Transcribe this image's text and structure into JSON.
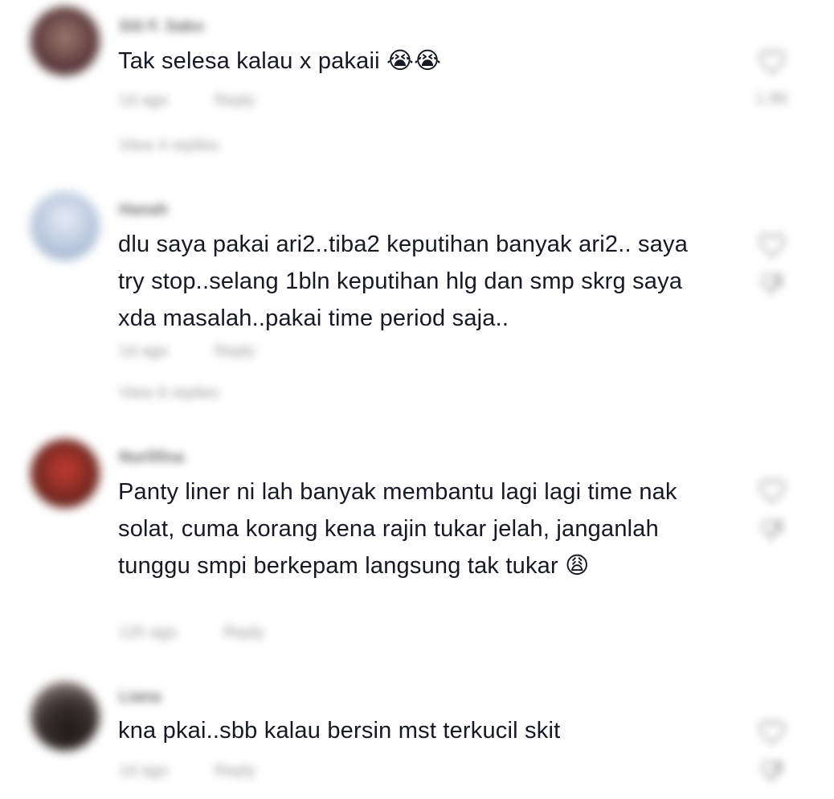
{
  "comments": [
    {
      "username": "Siti F. Sako",
      "text": "Tak selesa kalau x pakaii 😭😭",
      "time": "1d ago",
      "reply_label": "Reply",
      "view_replies": "View 4 replies",
      "likes": "1.8K",
      "avatar_color": "#6d4a4a"
    },
    {
      "username": "Hanah",
      "text": "dlu saya pakai ari2..tiba2 keputihan banyak ari2.. saya try stop..selang 1bln keputihan hlg dan smp skrg saya xda masalah..pakai time period saja..",
      "time": "1d ago",
      "reply_label": "Reply",
      "view_replies": "View 6 replies",
      "likes": "",
      "avatar_color": "#b8c8dc"
    },
    {
      "username": "Nurlifina",
      "text": "Panty liner ni lah banyak membantu lagi lagi time nak solat, cuma korang kena rajin tukar jelah, janganlah tunggu smpi berkepam langsung tak tukar 😩",
      "time": "12h ago",
      "reply_label": "Reply",
      "view_replies": "",
      "likes": "",
      "avatar_color": "#7a2a22"
    },
    {
      "username": "Liana",
      "text": "kna pkai..sbb kalau bersin mst terkucil skit",
      "time": "1d ago",
      "reply_label": "Reply",
      "view_replies": "",
      "likes": "",
      "avatar_color": "#3a3030"
    }
  ],
  "icons": {
    "like": "heart-icon",
    "dislike": "thumbs-down-icon"
  }
}
